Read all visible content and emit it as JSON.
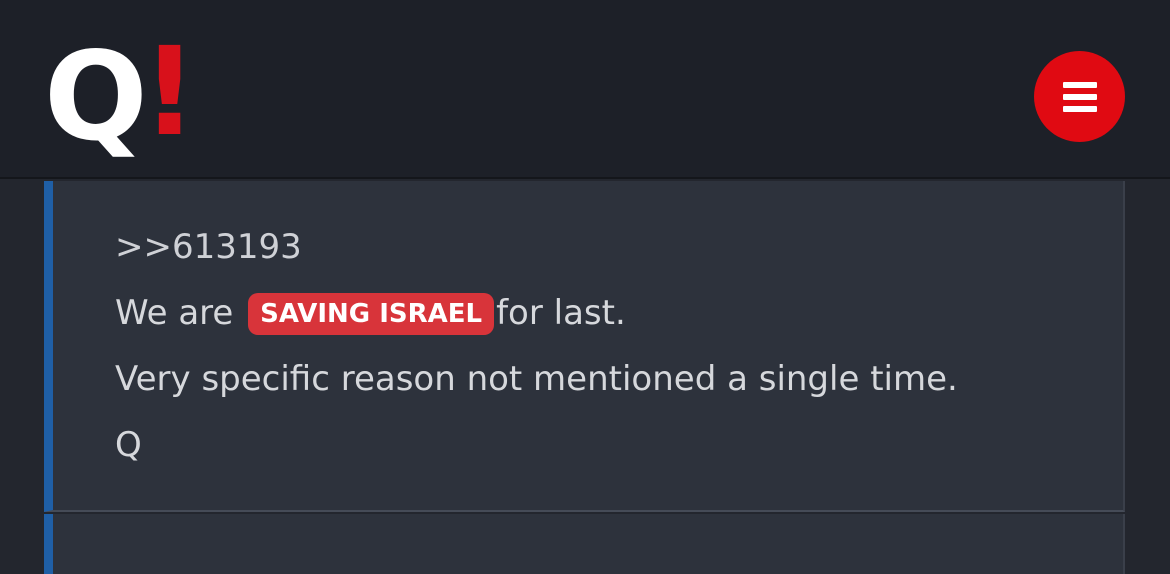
{
  "header": {
    "logo_letter": "Q",
    "logo_mark": "!",
    "menu_icon": "hamburger-menu-icon",
    "colors": {
      "brand_red": "#e00a12",
      "header_bg": "#1d2028"
    }
  },
  "post": {
    "reference": ">>613193",
    "line1_before": "We are ",
    "highlight": "SAVING ISRAEL",
    "line1_after": "for last.",
    "line2": "Very specific reason not mentioned a single time.",
    "signature": "Q",
    "colors": {
      "highlight_bg": "#d8343a",
      "accent_border": "#1f5fa6",
      "panel_bg": "#2d323c"
    }
  }
}
